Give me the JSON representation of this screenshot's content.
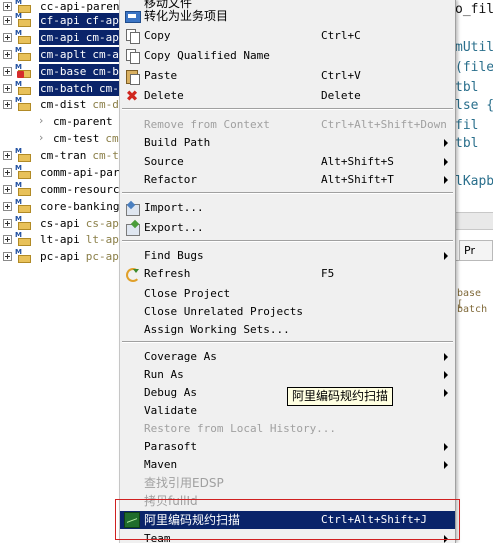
{
  "tree": {
    "items": [
      {
        "name": "cc-api-parent",
        "extra": "",
        "selected": false,
        "error": false,
        "child": false
      },
      {
        "name": "cf-api",
        "extra": "cf-ap",
        "selected": true,
        "error": false,
        "child": false
      },
      {
        "name": "cm-api",
        "extra": "cm-ap",
        "selected": true,
        "error": false,
        "child": false
      },
      {
        "name": "cm-aplt",
        "extra": "cm-ap",
        "selected": true,
        "error": false,
        "child": false
      },
      {
        "name": "cm-base",
        "extra": "cm-b",
        "selected": true,
        "error": true,
        "child": false
      },
      {
        "name": "cm-batch",
        "extra": "cm-",
        "selected": true,
        "error": false,
        "child": false
      },
      {
        "name": "cm-dist",
        "extra": "cm-d",
        "selected": false,
        "error": false,
        "child": false
      },
      {
        "name": "cm-parent",
        "extra": "",
        "selected": false,
        "error": false,
        "child": true
      },
      {
        "name": "cm-test",
        "extra": "cm",
        "selected": false,
        "error": false,
        "child": true
      },
      {
        "name": "cm-tran",
        "extra": "cm-t",
        "selected": false,
        "error": false,
        "child": false
      },
      {
        "name": "comm-api-paren",
        "extra": "",
        "selected": false,
        "error": false,
        "child": false
      },
      {
        "name": "comm-resource",
        "extra": "",
        "selected": false,
        "error": false,
        "child": false
      },
      {
        "name": "core-banking-",
        "extra": "",
        "selected": false,
        "error": false,
        "child": false
      },
      {
        "name": "cs-api",
        "extra": "cs-ap",
        "selected": false,
        "error": false,
        "child": false
      },
      {
        "name": "lt-api",
        "extra": "lt-ap",
        "selected": false,
        "error": false,
        "child": false
      },
      {
        "name": "pc-api",
        "extra": "pc-ap",
        "selected": false,
        "error": false,
        "child": false
      }
    ],
    "project_badge": "M"
  },
  "editor": {
    "lines": [
      {
        "text": "o_fil",
        "style": "dark"
      },
      {
        "text": "mUtil",
        "style": "tealt"
      },
      {
        "text": "(file",
        "style": "tealt"
      },
      {
        "text": " tbl",
        "style": "tealt"
      },
      {
        "text": "lse {",
        "style": "tealt"
      },
      {
        "text": " fil",
        "style": "tealt"
      },
      {
        "text": " tbl",
        "style": "tealt"
      },
      {
        "text": "lKapb",
        "style": "tealt"
      }
    ],
    "tab_label": "Pr",
    "small_lines": [
      "base [",
      "batch"
    ]
  },
  "menu": {
    "items": [
      {
        "type": "item",
        "label": "移动文件",
        "accel": "",
        "icon": "",
        "submenu": false,
        "disabled": false,
        "cn": true
      },
      {
        "type": "item",
        "label": "转化为业务项目",
        "accel": "",
        "icon": "biz",
        "submenu": false,
        "disabled": false,
        "cn": true
      },
      {
        "type": "item",
        "label": "Copy",
        "accel": "Ctrl+C",
        "icon": "copy",
        "submenu": false,
        "disabled": false
      },
      {
        "type": "item",
        "label": "Copy Qualified Name",
        "accel": "",
        "icon": "copy",
        "submenu": false,
        "disabled": false
      },
      {
        "type": "item",
        "label": "Paste",
        "accel": "Ctrl+V",
        "icon": "paste",
        "submenu": false,
        "disabled": false
      },
      {
        "type": "item",
        "label": "Delete",
        "accel": "Delete",
        "icon": "delete",
        "submenu": false,
        "disabled": false
      },
      {
        "type": "sep"
      },
      {
        "type": "item",
        "label": "Remove from Context",
        "accel": "Ctrl+Alt+Shift+Down",
        "icon": "",
        "submenu": false,
        "disabled": true
      },
      {
        "type": "item",
        "label": "Build Path",
        "accel": "",
        "icon": "",
        "submenu": true,
        "disabled": false
      },
      {
        "type": "item",
        "label": "Source",
        "accel": "Alt+Shift+S",
        "icon": "",
        "submenu": true,
        "disabled": false
      },
      {
        "type": "item",
        "label": "Refactor",
        "accel": "Alt+Shift+T",
        "icon": "",
        "submenu": true,
        "disabled": false
      },
      {
        "type": "sep"
      },
      {
        "type": "item",
        "label": "Import...",
        "accel": "",
        "icon": "import",
        "submenu": false,
        "disabled": false
      },
      {
        "type": "item",
        "label": "Export...",
        "accel": "",
        "icon": "export",
        "submenu": false,
        "disabled": false
      },
      {
        "type": "sep"
      },
      {
        "type": "item",
        "label": "Find Bugs",
        "accel": "",
        "icon": "",
        "submenu": true,
        "disabled": false
      },
      {
        "type": "item",
        "label": "Refresh",
        "accel": "F5",
        "icon": "refresh",
        "submenu": false,
        "disabled": false
      },
      {
        "type": "item",
        "label": "Close Project",
        "accel": "",
        "icon": "",
        "submenu": false,
        "disabled": false
      },
      {
        "type": "item",
        "label": "Close Unrelated Projects",
        "accel": "",
        "icon": "",
        "submenu": false,
        "disabled": false
      },
      {
        "type": "item",
        "label": "Assign Working Sets...",
        "accel": "",
        "icon": "",
        "submenu": false,
        "disabled": false
      },
      {
        "type": "sep"
      },
      {
        "type": "item",
        "label": "Coverage As",
        "accel": "",
        "icon": "",
        "submenu": true,
        "disabled": false
      },
      {
        "type": "item",
        "label": "Run As",
        "accel": "",
        "icon": "",
        "submenu": true,
        "disabled": false
      },
      {
        "type": "item",
        "label": "Debug As",
        "accel": "",
        "icon": "",
        "submenu": true,
        "disabled": false
      },
      {
        "type": "item",
        "label": "Validate",
        "accel": "",
        "icon": "",
        "submenu": false,
        "disabled": false
      },
      {
        "type": "item",
        "label": "Restore from Local History...",
        "accel": "",
        "icon": "",
        "submenu": false,
        "disabled": true
      },
      {
        "type": "item",
        "label": "Parasoft",
        "accel": "",
        "icon": "",
        "submenu": true,
        "disabled": false
      },
      {
        "type": "item",
        "label": "Maven",
        "accel": "",
        "icon": "",
        "submenu": true,
        "disabled": false
      },
      {
        "type": "item",
        "label": "查找引用EDSP",
        "accel": "",
        "icon": "",
        "submenu": false,
        "disabled": true,
        "cn": true
      },
      {
        "type": "item",
        "label": "拷贝fullId",
        "accel": "",
        "icon": "",
        "submenu": false,
        "disabled": true,
        "cn": true
      },
      {
        "type": "item",
        "label": "阿里编码规约扫描",
        "accel": "Ctrl+Alt+Shift+J",
        "icon": "scan",
        "submenu": false,
        "disabled": false,
        "cn": true,
        "highlighted": true
      },
      {
        "type": "item",
        "label": "Team",
        "accel": "",
        "icon": "",
        "submenu": true,
        "disabled": false
      }
    ]
  },
  "tooltip": {
    "text": "阿里编码规约扫描"
  },
  "colors": {
    "selection": "#0a246a",
    "menu_bg": "#f0f0f0",
    "red_outline": "#d02020",
    "tooltip_bg": "#ffffe1"
  }
}
